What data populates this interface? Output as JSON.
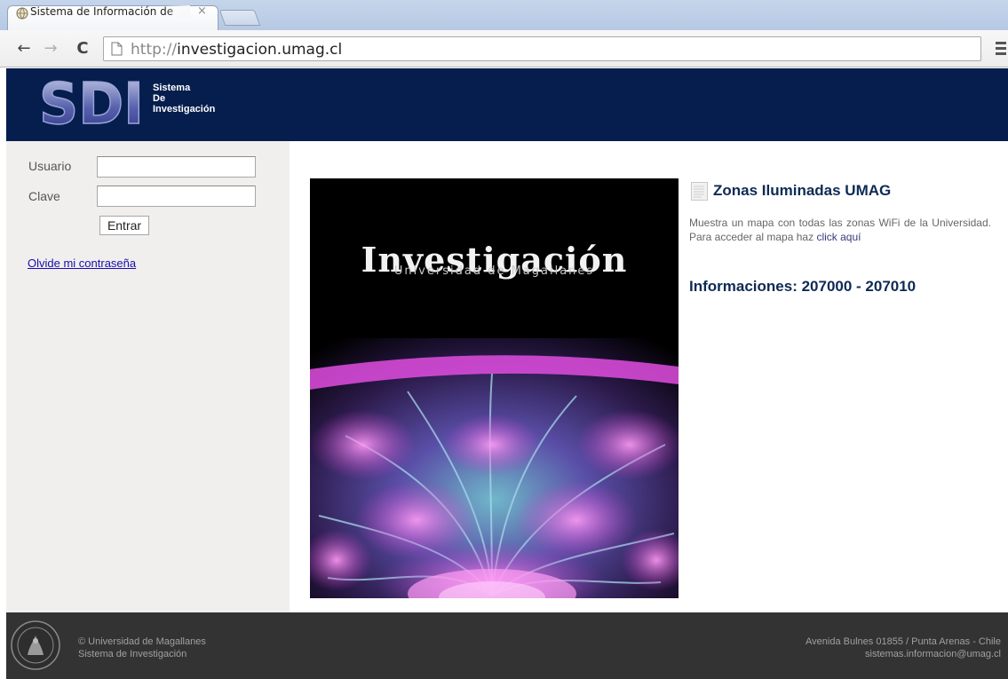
{
  "browser": {
    "tab_title": "Sistema de Información de",
    "tab_close": "×",
    "url_protocol": "http://",
    "url_host": "investigacion.umag.cl"
  },
  "header": {
    "logo_letters": "SDI",
    "logo_line1": "Sistema",
    "logo_line2": "De",
    "logo_line3": "Investigación",
    "bg_color": "#061e4e"
  },
  "login": {
    "user_label": "Usuario",
    "password_label": "Clave",
    "user_value": "",
    "password_value": "",
    "submit_label": "Entrar",
    "forgot_link": "Olvide mi contraseña"
  },
  "poster": {
    "title": "Investigación",
    "subtitle": "Universidad de Magallanes"
  },
  "news": {
    "title": "Zonas Iluminadas UMAG",
    "description": "Muestra un mapa con todas las zonas WiFi de la Universidad. Para acceder al mapa haz",
    "link_text": "click aquí",
    "info_title": "Informaciones: 207000 - 207010"
  },
  "footer": {
    "left_line1": "© Universidad de Magallanes",
    "left_line2": "Sistema de Investigación",
    "right_line1": "Avenida Bulnes 01855 / Punta Arenas - Chile",
    "right_line2": "sistemas.informacion@umag.cl",
    "bg_color": "#333333"
  }
}
